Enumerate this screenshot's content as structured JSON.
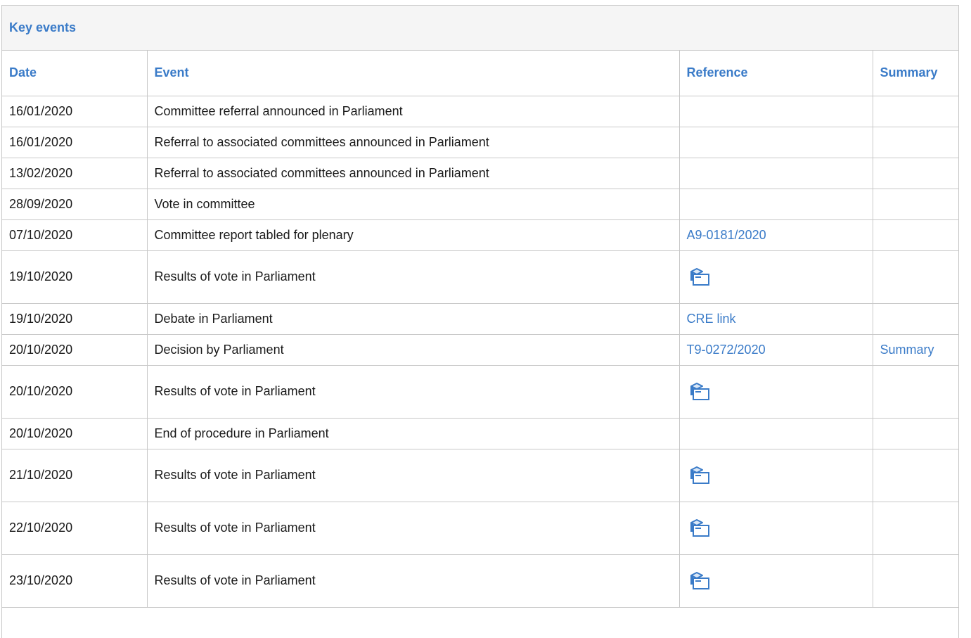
{
  "panel": {
    "title": "Key events"
  },
  "columns": {
    "date": "Date",
    "event": "Event",
    "reference": "Reference",
    "summary": "Summary"
  },
  "rows": [
    {
      "date": "16/01/2020",
      "event": "Committee referral announced in Parliament",
      "reference": "",
      "reference_type": "none",
      "summary": ""
    },
    {
      "date": "16/01/2020",
      "event": "Referral to associated committees announced in Parliament",
      "reference": "",
      "reference_type": "none",
      "summary": ""
    },
    {
      "date": "13/02/2020",
      "event": "Referral to associated committees announced in Parliament",
      "reference": "",
      "reference_type": "none",
      "summary": ""
    },
    {
      "date": "28/09/2020",
      "event": "Vote in committee",
      "reference": "",
      "reference_type": "none",
      "summary": ""
    },
    {
      "date": "07/10/2020",
      "event": "Committee report tabled for plenary",
      "reference": "A9-0181/2020",
      "reference_type": "link",
      "summary": ""
    },
    {
      "date": "19/10/2020",
      "event": "Results of vote in Parliament",
      "reference": "",
      "reference_type": "vote-icon",
      "summary": ""
    },
    {
      "date": "19/10/2020",
      "event": "Debate in Parliament",
      "reference": "CRE link",
      "reference_type": "link",
      "summary": ""
    },
    {
      "date": "20/10/2020",
      "event": "Decision by Parliament",
      "reference": "T9-0272/2020",
      "reference_type": "link",
      "summary": "Summary"
    },
    {
      "date": "20/10/2020",
      "event": "Results of vote in Parliament",
      "reference": "",
      "reference_type": "vote-icon",
      "summary": ""
    },
    {
      "date": "20/10/2020",
      "event": "End of procedure in Parliament",
      "reference": "",
      "reference_type": "none",
      "summary": ""
    },
    {
      "date": "21/10/2020",
      "event": "Results of vote in Parliament",
      "reference": "",
      "reference_type": "vote-icon",
      "summary": ""
    },
    {
      "date": "22/10/2020",
      "event": "Results of vote in Parliament",
      "reference": "",
      "reference_type": "vote-icon",
      "summary": ""
    },
    {
      "date": "23/10/2020",
      "event": "Results of vote in Parliament",
      "reference": "",
      "reference_type": "vote-icon",
      "summary": ""
    }
  ],
  "colors": {
    "accent": "#3a7bc8",
    "border": "#c8c8c8",
    "header_bg": "#f5f5f5"
  },
  "icons": {
    "vote": "vote-result-icon"
  }
}
